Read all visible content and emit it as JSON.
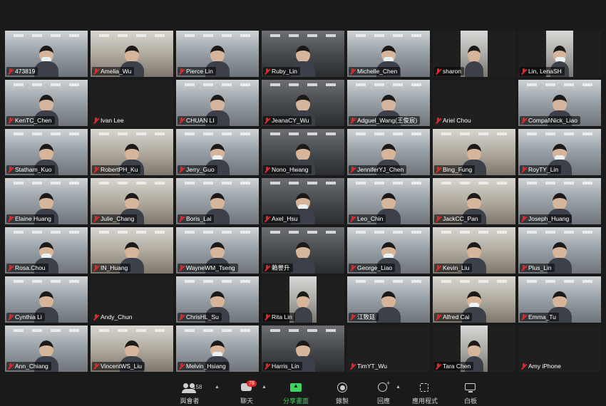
{
  "participants": [
    {
      "name": "473819",
      "video": true
    },
    {
      "name": "Amelia_Wu",
      "video": true
    },
    {
      "name": "Pierce Lin",
      "video": true
    },
    {
      "name": "Ruby_Lin",
      "video": true
    },
    {
      "name": "Michelle_Chen",
      "video": true
    },
    {
      "name": "sharon",
      "video": true,
      "portrait": true
    },
    {
      "name": "Lin, LenaSH",
      "video": true,
      "portrait": true
    },
    {
      "name": "KenTC_Chen",
      "video": true
    },
    {
      "name": "Ivan Lee",
      "video": false
    },
    {
      "name": "CHUAN LI",
      "video": true
    },
    {
      "name": "JeanaCY_Wu",
      "video": true
    },
    {
      "name": "Adguel_Wang(王俊宸)",
      "video": true
    },
    {
      "name": "Ariel Chou",
      "video": false
    },
    {
      "name": "Compal\\Nick_Liao",
      "video": true
    },
    {
      "name": "Statham_Kuo",
      "video": true
    },
    {
      "name": "RobertPH_Ku",
      "video": true
    },
    {
      "name": "Jerry_Guo",
      "video": true
    },
    {
      "name": "Nono_Hwang",
      "video": true
    },
    {
      "name": "JenniferYJ_Chen",
      "video": true
    },
    {
      "name": "Bing_Fung",
      "video": true
    },
    {
      "name": "RoyTY_Lin",
      "video": true
    },
    {
      "name": "Elaine Huang",
      "video": true
    },
    {
      "name": "Julie_Chang",
      "video": true
    },
    {
      "name": "Boris_Lai",
      "video": true
    },
    {
      "name": "Axel_Hsu",
      "video": true
    },
    {
      "name": "Leo_Chin",
      "video": true
    },
    {
      "name": "JackCC_Pan",
      "video": true
    },
    {
      "name": "Joseph_Huang",
      "video": true
    },
    {
      "name": "Rosa.Chou",
      "video": true
    },
    {
      "name": "IN_Huang",
      "video": true
    },
    {
      "name": "WayneWM_Tseng",
      "video": true
    },
    {
      "name": "賴譽升",
      "video": true
    },
    {
      "name": "George_Liao",
      "video": true
    },
    {
      "name": "Kevin_Liu",
      "video": true
    },
    {
      "name": "Plus_Lin",
      "video": true
    },
    {
      "name": "Cynthia Li",
      "video": true
    },
    {
      "name": "Andy_Chun",
      "video": false
    },
    {
      "name": "ChrisHL_Su",
      "video": true
    },
    {
      "name": "Rita Lin",
      "video": true,
      "portrait": true
    },
    {
      "name": "江致廷",
      "video": true
    },
    {
      "name": "Alfred Cai",
      "video": true
    },
    {
      "name": "Emma_Tu",
      "video": true
    },
    {
      "name": "Ann_Chiang",
      "video": true
    },
    {
      "name": "VincentWS_Liu",
      "video": true
    },
    {
      "name": "Melvin_Hsiang",
      "video": true
    },
    {
      "name": "Harris_Lin",
      "video": true
    },
    {
      "name": "TimYT_Wu",
      "video": false
    },
    {
      "name": "Tara Chen",
      "video": true,
      "portrait": true
    },
    {
      "name": "Amy iPhone",
      "video": false
    }
  ],
  "toolbar": {
    "participants": {
      "label": "與會者",
      "count": "158",
      "icon": "people-icon"
    },
    "chat": {
      "label": "聊天",
      "badge": "78",
      "icon": "chat-icon"
    },
    "share": {
      "label": "分享畫面",
      "icon": "share-screen-icon",
      "color": "#3fd460"
    },
    "record": {
      "label": "錄製",
      "icon": "record-icon"
    },
    "reactions": {
      "label": "回應",
      "icon": "reaction-icon"
    },
    "apps": {
      "label": "應用程式",
      "icon": "apps-icon"
    },
    "whiteboard": {
      "label": "白板",
      "icon": "whiteboard-icon"
    }
  },
  "colors": {
    "background": "#1a1a1a",
    "muted_mic": "#e02828",
    "share_green": "#3fd460"
  }
}
